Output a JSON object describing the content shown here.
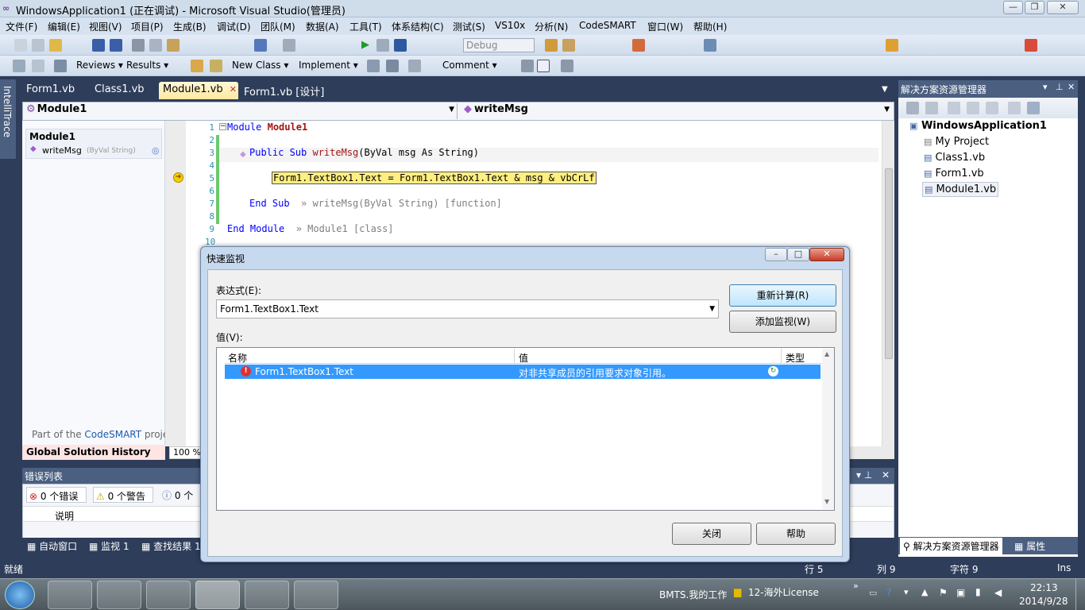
{
  "window": {
    "title": "WindowsApplication1 (正在调试) - Microsoft Visual Studio(管理员)",
    "min": "—",
    "max": "❐",
    "close": "✕"
  },
  "menu": [
    "文件(F)",
    "编辑(E)",
    "视图(V)",
    "项目(P)",
    "生成(B)",
    "调试(D)",
    "团队(M)",
    "数据(A)",
    "工具(T)",
    "体系结构(C)",
    "测试(S)",
    "VS10x",
    "分析(N)",
    "CodeSMART",
    "窗口(W)",
    "帮助(H)"
  ],
  "toolbar1": {
    "config": "Debug"
  },
  "toolbar2": {
    "reviews": "Reviews ▾",
    "results": "Results ▾",
    "new_class": "New Class ▾",
    "implement": "Implement ▾",
    "comment": "Comment ▾"
  },
  "intellitrace": "IntelliTrace",
  "tabs": [
    "Form1.vb",
    "Class1.vb",
    "Module1.vb",
    "Form1.vb [设计]"
  ],
  "active_tab": "Module1.vb",
  "nav": {
    "left": "Module1",
    "right": "writeMsg"
  },
  "outline": {
    "module": "Module1",
    "member": "writeMsg",
    "member_sig": "(ByVal String)",
    "footer_prefix": "Part of the ",
    "footer_link": "CodeSMART",
    "footer_suffix": " project",
    "history": "Global Solution History"
  },
  "zoom": "100 %",
  "code": {
    "line_numbers": [
      "1",
      "2",
      "3",
      "4",
      "5",
      "6",
      "7",
      "8",
      "9",
      "10"
    ],
    "l1_kw": "Module",
    "l1_name": "Module1",
    "l3_kw": "Public Sub",
    "l3_name": "writeMsg",
    "l3_params": "(ByVal msg As String)",
    "l5": "Form1.TextBox1.Text = Form1.TextBox1.Text & msg & vbCrLf",
    "l7_kw": "End Sub",
    "l7_hint": "» writeMsg(ByVal String) [function]",
    "l9_kw": "End Module",
    "l9_hint": "» Module1 [class]"
  },
  "error_list": {
    "title": "错误列表",
    "errors": "0 个错误",
    "warnings": "0 个警告",
    "messages": "0 个",
    "col_desc": "说明"
  },
  "bottom_tabs": [
    "自动窗口",
    "监视 1",
    "查找结果 1"
  ],
  "solution_explorer": {
    "title": "解决方案资源管理器",
    "root": "WindowsApplication1",
    "items": [
      "My Project",
      "Class1.vb",
      "Form1.vb",
      "Module1.vb"
    ],
    "tab_se": "解决方案资源管理器",
    "tab_props": "属性"
  },
  "status": {
    "ready": "就绪",
    "row": "行 5",
    "col": "列 9",
    "char": "字符 9",
    "ins": "Ins"
  },
  "quickwatch": {
    "title": "快速监视",
    "expr_label": "表达式(E):",
    "expr_value": "Form1.TextBox1.Text",
    "recalc": "重新计算(R)",
    "add_watch": "添加监视(W)",
    "value_label": "值(V):",
    "col_name": "名称",
    "col_value": "值",
    "col_type": "类型",
    "row_name": "Form1.TextBox1.Text",
    "row_value": "对非共享成员的引用要求对象引用。",
    "row_type": "",
    "close": "关闭",
    "help": "帮助"
  },
  "taskbar": {
    "item1": "BMTS.我的工作",
    "item2": "12-海外License",
    "time": "22:13",
    "date": "2014/9/28"
  }
}
